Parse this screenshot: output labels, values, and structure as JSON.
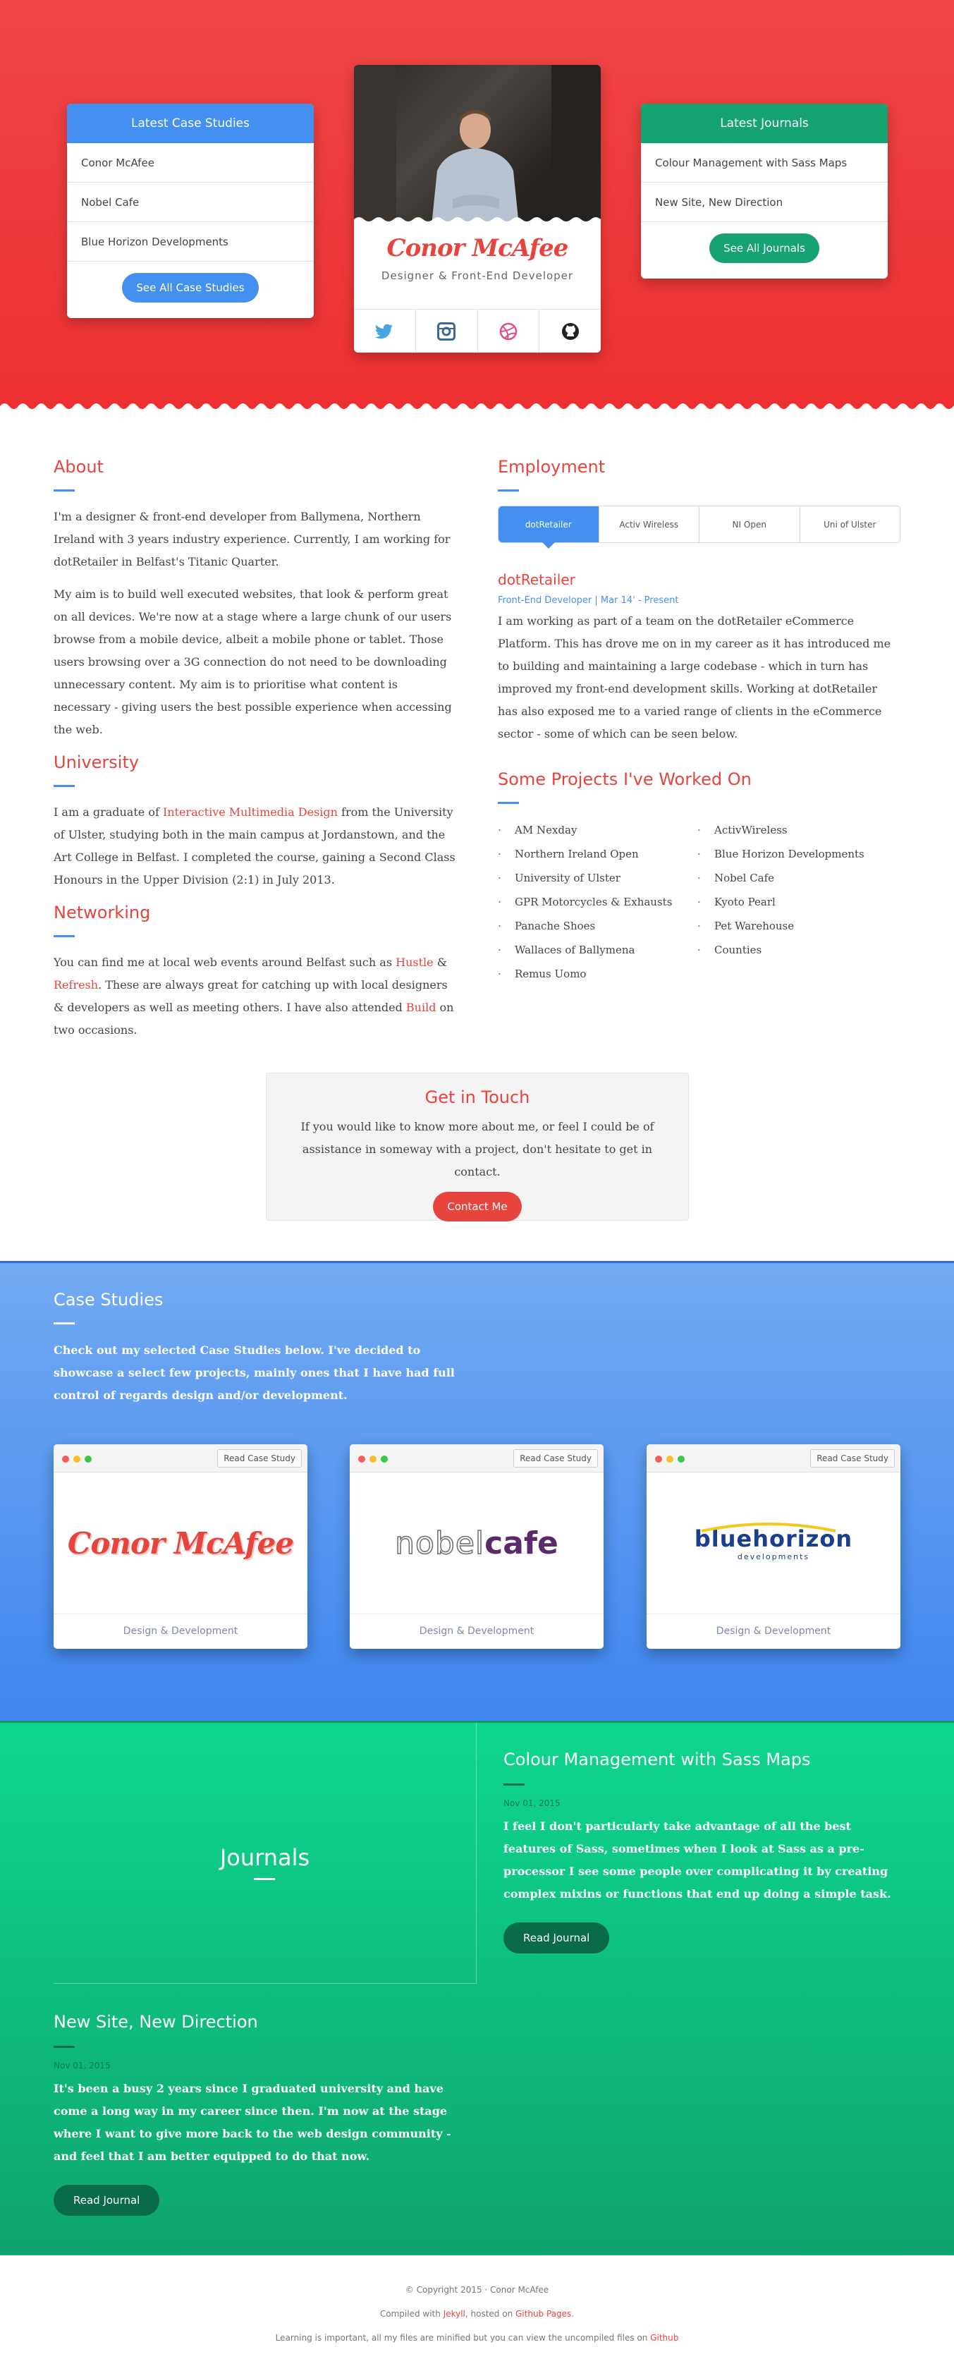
{
  "hero": {
    "case_studies_card": {
      "title": "Latest Case Studies",
      "items": [
        "Conor McAfee",
        "Nobel Cafe",
        "Blue Horizon Developments"
      ],
      "button": "See All Case Studies"
    },
    "profile": {
      "name": "Conor McAfee",
      "role": "Designer & Front-End Developer",
      "socials": [
        "twitter-icon",
        "instagram-icon",
        "dribbble-icon",
        "github-icon"
      ]
    },
    "journals_card": {
      "title": "Latest Journals",
      "items": [
        "Colour Management with Sass Maps",
        "New Site, New Direction"
      ],
      "button": "See All Journals"
    }
  },
  "about": {
    "heading": "About",
    "p1": "I'm a designer & front-end developer from Ballymena, Northern Ireland with 3 years industry experience. Currently, I am working for dotRetailer in Belfast's Titanic Quarter.",
    "p2": "My aim is to build well executed websites, that look & perform great on all devices. We're now at a stage where a large chunk of our users browse from a mobile device, albeit a mobile phone or tablet. Those users browsing over a 3G connection do not need to be downloading unnecessary content. My aim is to prioritise what content is necessary - giving users the best possible experience when accessing the web."
  },
  "university": {
    "heading": "University",
    "pre": "I am a graduate of ",
    "link": "Interactive Multimedia Design",
    "post": " from the University of Ulster, studying both in the main campus at Jordanstown, and the Art College in Belfast. I completed the course, gaining a Second Class Honours in the Upper Division (2:1) in July 2013."
  },
  "networking": {
    "heading": "Networking",
    "t1": "You can find me at local web events around Belfast such as ",
    "link1": "Hustle",
    "t2": " & ",
    "link2": "Refresh",
    "t3": ". These are always great for catching up with local designers & developers as well as meeting others. I have also attended ",
    "link3": "Build",
    "t4": " on two occasions."
  },
  "employment": {
    "heading": "Employment",
    "tabs": [
      "dotRetailer",
      "Activ Wireless",
      "NI Open",
      "Uni of Ulster"
    ],
    "company": "dotRetailer",
    "meta": "Front-End Developer | Mar 14' - Present",
    "text": "I am working as part of a team on the dotRetailer eCommerce Platform. This has drove me on in my career as it has introduced me to building and maintaining a large codebase - which in turn has improved my front-end development skills. Working at dotRetailer has also exposed me to a varied range of clients in the eCommerce sector - some of which can be seen below."
  },
  "projects": {
    "heading": "Some Projects I've Worked On",
    "col1": [
      "AM Nexday",
      "Northern Ireland Open",
      "University of Ulster",
      "GPR Motorcycles & Exhausts",
      "Panache Shoes",
      "Wallaces of Ballymena",
      "Remus Uomo"
    ],
    "col2": [
      "ActivWireless",
      "Blue Horizon Developments",
      "Nobel Cafe",
      "Kyoto Pearl",
      "Pet Warehouse",
      "Counties"
    ]
  },
  "contact": {
    "heading": "Get in Touch",
    "text": "If you would like to know more about me, or feel I could be of assistance in someway with a project, don't hesitate to get in contact.",
    "button": "Contact Me"
  },
  "case_studies": {
    "heading": "Case Studies",
    "text": "Check out my selected Case Studies below. I've decided to showcase a select few projects, mainly ones that I have had full control of regards design and/or development.",
    "items": [
      {
        "logo": "Conor McAfee",
        "button": "Read Case Study",
        "caption": "Design & Development"
      },
      {
        "logo_a": "nobel",
        "logo_b": "cafe",
        "button": "Read Case Study",
        "caption": "Design & Development"
      },
      {
        "logo_a": "bluehorizon",
        "logo_sub": "developments",
        "button": "Read Case Study",
        "caption": "Design & Development"
      }
    ]
  },
  "journals": {
    "heading": "Journals",
    "entries": [
      {
        "title": "Colour Management with Sass Maps",
        "date": "Nov 01, 2015",
        "text": "I feel I don't particularly take advantage of all the best features of Sass, sometimes when I look at Sass as a pre-processor I see some people over complicating it by creating complex mixins or functions that end up doing a simple task.",
        "button": "Read Journal"
      },
      {
        "title": "New Site, New Direction",
        "date": "Nov 01, 2015",
        "text": "It's been a busy 2 years since I graduated university and have come a long way in my career since then. I'm now at the stage where I want to give more back to the web design community - and feel that I am better equipped to do that now.",
        "button": "Read Journal"
      }
    ]
  },
  "footer": {
    "copyright": "© Copyright 2015 · Conor McAfee",
    "compiled_pre": "Compiled with ",
    "jekyll": "Jekyll",
    "compiled_mid": ", hosted on ",
    "github_pages": "Github Pages",
    "compiled_post": ".",
    "learning_pre": "Learning is important, all my files are minified but you can view the uncompiled files on ",
    "github": "Github"
  },
  "colors": {
    "red": "#e8443e",
    "blue": "#4390f0",
    "green": "#15a372"
  }
}
